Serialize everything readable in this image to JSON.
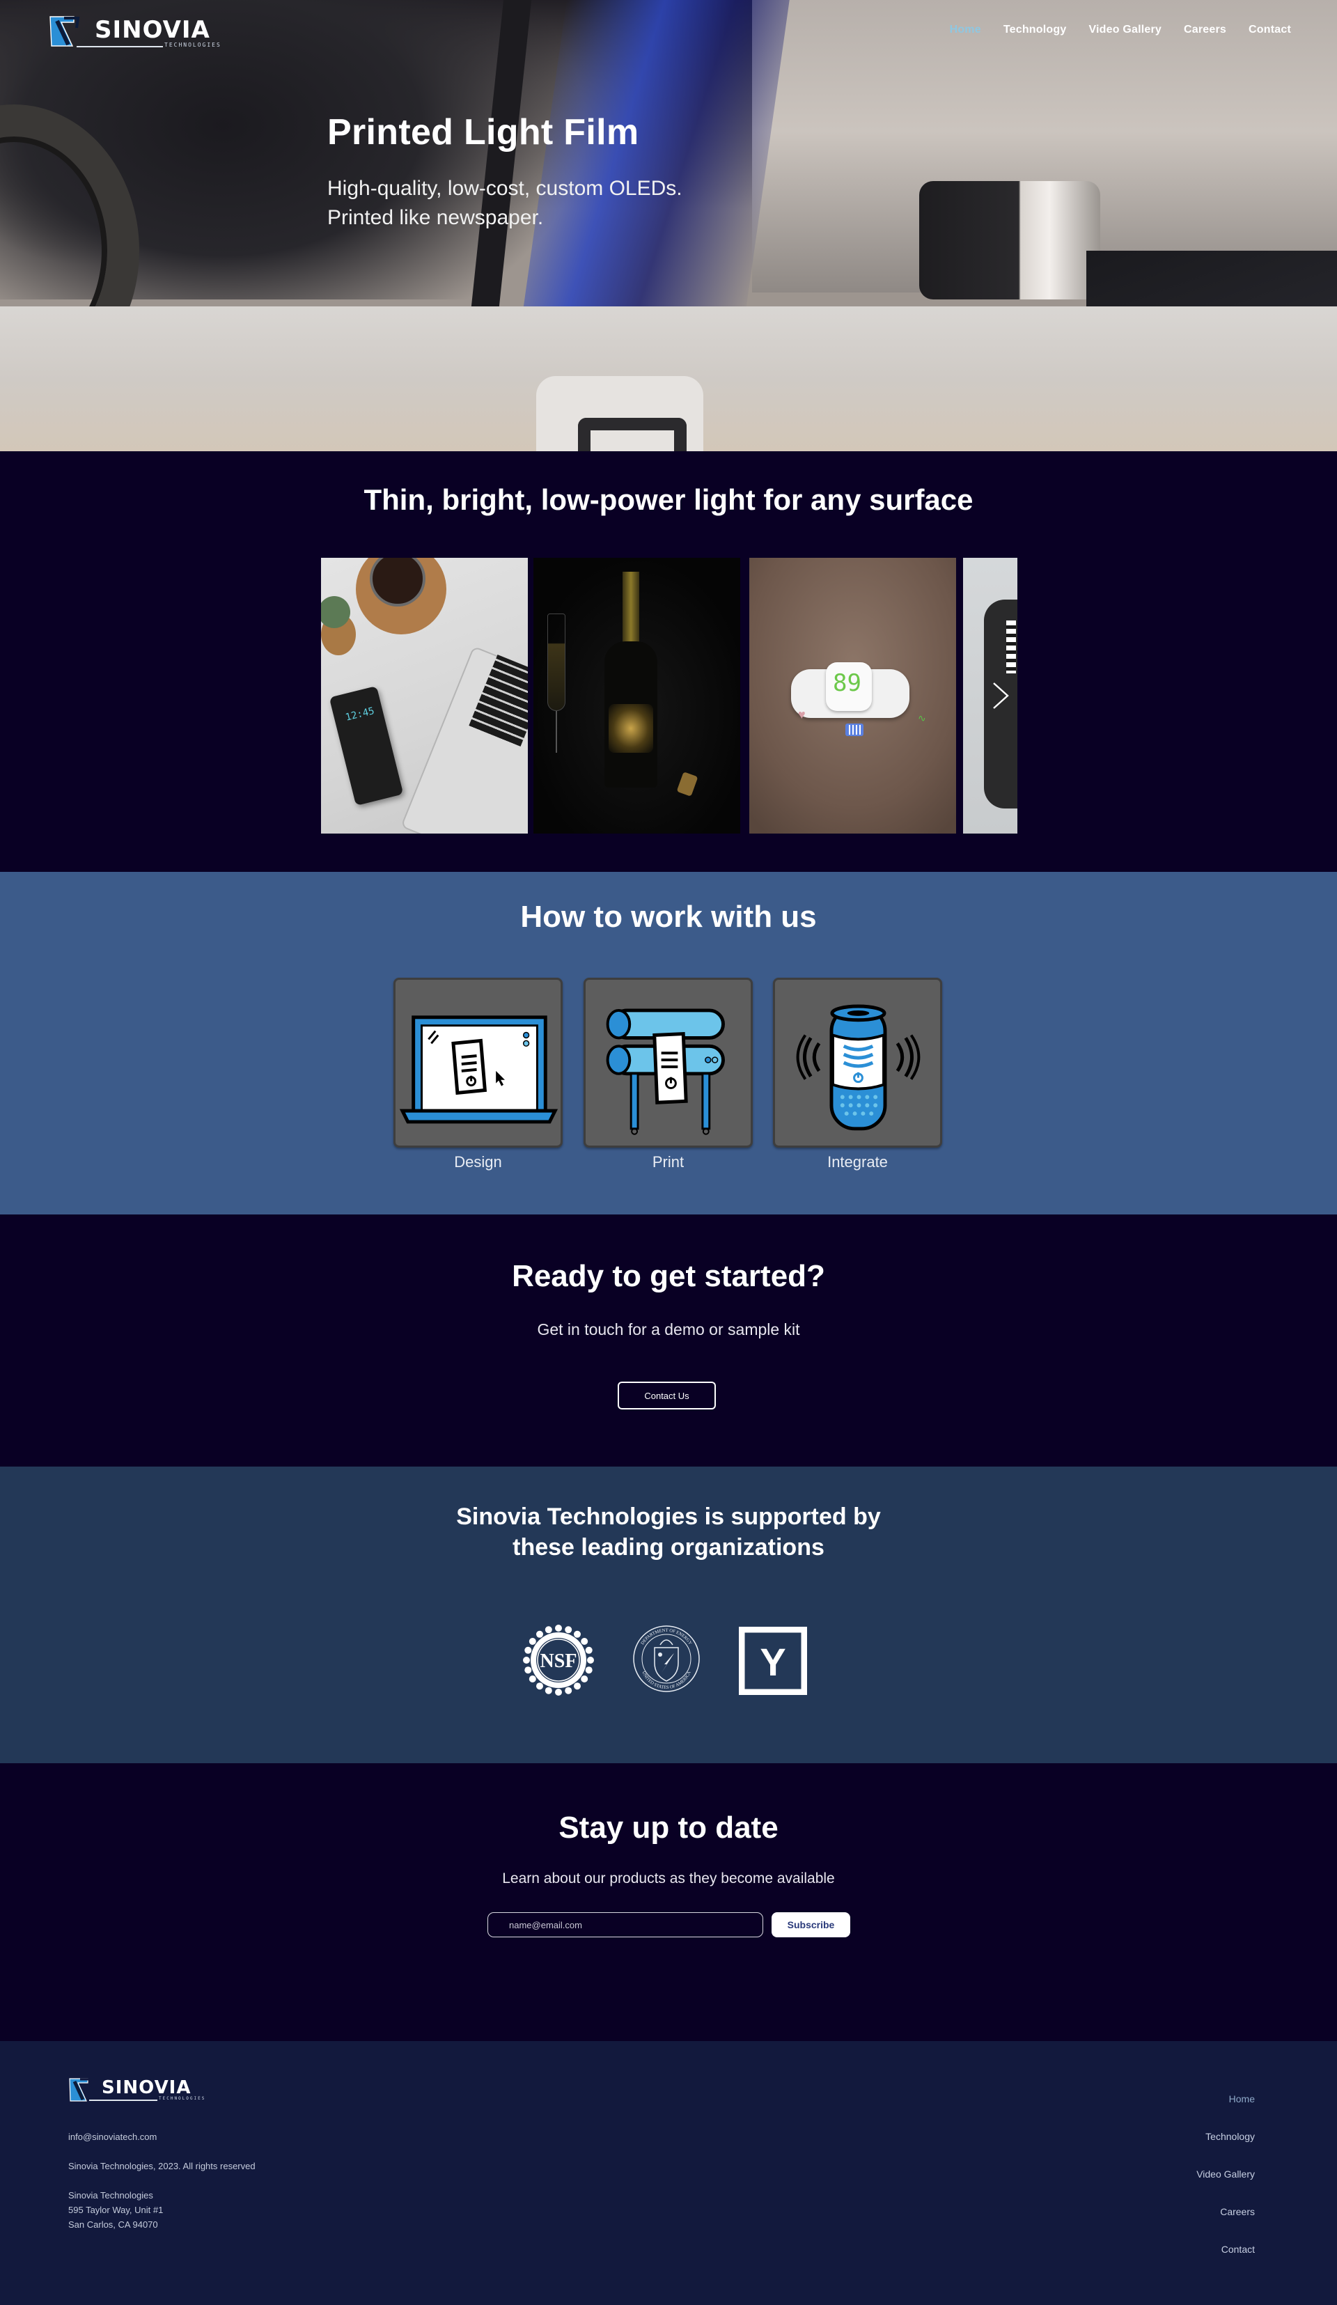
{
  "header": {
    "logo": {
      "name": "SINOVIA",
      "tagline": "TECHNOLOGIES"
    },
    "nav": [
      {
        "label": "Home",
        "active": true
      },
      {
        "label": "Technology",
        "active": false
      },
      {
        "label": "Video Gallery",
        "active": false
      },
      {
        "label": "Careers",
        "active": false
      },
      {
        "label": "Contact",
        "active": false
      }
    ]
  },
  "hero": {
    "title": "Printed Light Film",
    "subtitle": "High-quality, low-cost, custom OLEDs. Printed like newspaper."
  },
  "showcase": {
    "title": "Thin, bright, low-power light for any surface",
    "slides": [
      {
        "name": "phone-case-clock",
        "display_text": "12:45"
      },
      {
        "name": "champagne-bottle-label"
      },
      {
        "name": "skin-patch-sensor",
        "display_text": "89"
      },
      {
        "name": "wearable-device"
      }
    ],
    "next_arrow": "chevron-right-icon"
  },
  "work": {
    "title": "How to work with us",
    "steps": [
      {
        "label": "Design",
        "icon": "laptop-design-icon"
      },
      {
        "label": "Print",
        "icon": "printer-rollers-icon"
      },
      {
        "label": "Integrate",
        "icon": "smart-speaker-icon"
      }
    ]
  },
  "cta": {
    "title": "Ready to get started?",
    "subtitle": "Get in touch for a demo or sample kit",
    "button_label": "Contact Us"
  },
  "support": {
    "title_line1": "Sinovia Technologies is supported by",
    "title_line2": "these leading organizations",
    "orgs": [
      {
        "name": "nsf",
        "label": "NSF"
      },
      {
        "name": "department-of-energy",
        "ring_top": "DEPARTMENT OF ENERGY",
        "ring_bottom": "UNITED STATES OF AMERICA"
      },
      {
        "name": "y-combinator",
        "label": "Y"
      }
    ]
  },
  "newsletter": {
    "title": "Stay up to date",
    "subtitle": "Learn about our products as they become available",
    "email_placeholder": "name@email.com",
    "email_value": "",
    "button_label": "Subscribe"
  },
  "footer": {
    "logo": {
      "name": "SINOVIA",
      "tagline": "TECHNOLOGIES"
    },
    "email": "info@sinoviatech.com",
    "copyright": "Sinovia Technologies, 2023. All rights reserved",
    "address": [
      "Sinovia Technologies",
      "595 Taylor Way, Unit #1",
      "San Carlos, CA 94070"
    ],
    "nav": [
      {
        "label": "Home",
        "active": true
      },
      {
        "label": "Technology",
        "active": false
      },
      {
        "label": "Video Gallery",
        "active": false
      },
      {
        "label": "Careers",
        "active": false
      },
      {
        "label": "Contact",
        "active": false
      }
    ]
  },
  "colors": {
    "navy_dark": "#090024",
    "work_blue": "#3c5b8a",
    "support_blue": "#233857",
    "footer_navy": "#12193d",
    "brand_blue": "#2b8fd6",
    "nav_active": "#8fc7e1"
  }
}
